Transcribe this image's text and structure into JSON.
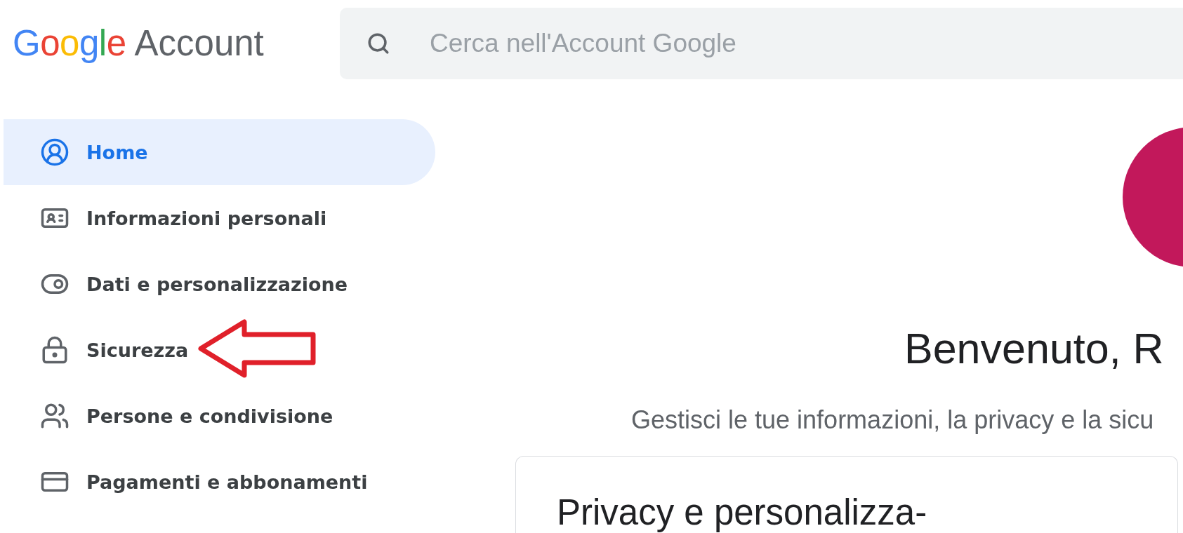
{
  "header": {
    "logo": {
      "brand": "Google",
      "product": "Account"
    },
    "search": {
      "placeholder": "Cerca nell'Account Google"
    }
  },
  "sidebar": {
    "items": [
      {
        "label": "Home",
        "selected": true
      },
      {
        "label": "Informazioni personali",
        "selected": false
      },
      {
        "label": "Dati e personalizzazione",
        "selected": false
      },
      {
        "label": "Sicurezza",
        "selected": false
      },
      {
        "label": "Persone e condivisione",
        "selected": false
      },
      {
        "label": "Pagamenti e abbonamenti",
        "selected": false
      }
    ]
  },
  "main": {
    "greeting": "Benvenuto, R",
    "subtitle": "Gestisci le tue informazioni, la privacy e la sicu",
    "card": {
      "title": "Privacy e personalizza-"
    }
  }
}
